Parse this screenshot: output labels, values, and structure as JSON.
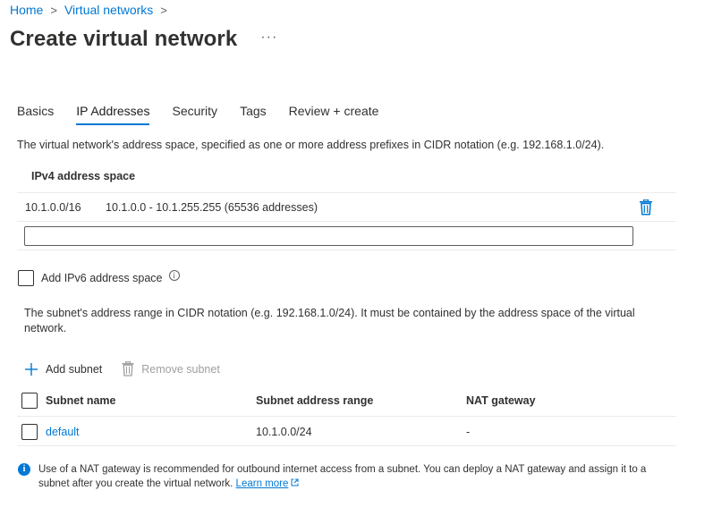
{
  "breadcrumb": {
    "home": "Home",
    "sep1": ">",
    "virtual_networks": "Virtual networks",
    "sep2": ">"
  },
  "page": {
    "title": "Create virtual network",
    "more": "···"
  },
  "tabs": [
    {
      "label": "Basics",
      "active": false
    },
    {
      "label": "IP Addresses",
      "active": true
    },
    {
      "label": "Security",
      "active": false
    },
    {
      "label": "Tags",
      "active": false
    },
    {
      "label": "Review + create",
      "active": false
    }
  ],
  "ip_addresses": {
    "description": "The virtual network's address space, specified as one or more address prefixes in CIDR notation (e.g. 192.168.1.0/24).",
    "column_header": "IPv4 address space",
    "rows": [
      {
        "cidr": "10.1.0.0/16",
        "range": "10.1.0.0 - 10.1.255.255 (65536 addresses)"
      }
    ],
    "new_prefix_value": "",
    "ipv6_checkbox_label": "Add IPv6 address space",
    "info_glyph": "i"
  },
  "subnets": {
    "description": "The subnet's address range in CIDR notation (e.g. 192.168.1.0/24). It must be contained by the address space of the virtual network.",
    "add_label": "Add subnet",
    "remove_label": "Remove subnet",
    "headers": {
      "name": "Subnet name",
      "range": "Subnet address range",
      "nat": "NAT gateway"
    },
    "rows": [
      {
        "name": "default",
        "range": "10.1.0.0/24",
        "nat": "-"
      }
    ]
  },
  "note": {
    "text": "Use of a NAT gateway is recommended for outbound internet access from a subnet. You can deploy a NAT gateway and assign it to a subnet after you create the virtual network.",
    "link": "Learn more"
  },
  "colors": {
    "accent": "#0078d4",
    "text": "#323130",
    "border": "#edebe9",
    "disabled": "#a19f9d"
  }
}
